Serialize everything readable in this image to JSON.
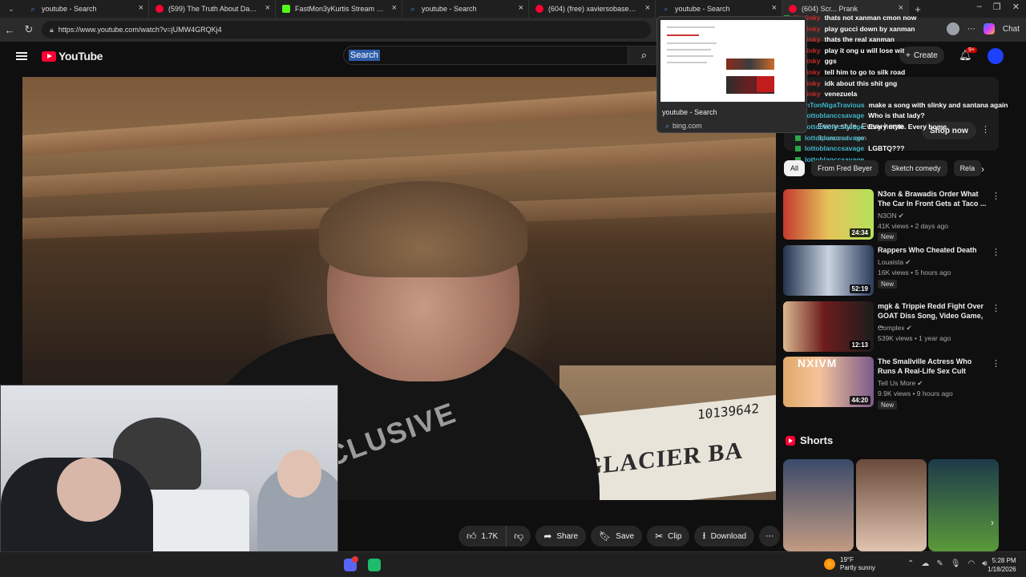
{
  "browser": {
    "tabs": [
      {
        "label": "youtube - Search",
        "favicon": "bing"
      },
      {
        "label": "(599) The Truth About Dark Web Da",
        "favicon": "youtube"
      },
      {
        "label": "FastMon3yKurtis Stream - Watch Liv",
        "favicon": "kick"
      },
      {
        "label": "youtube - Search",
        "favicon": "bing"
      },
      {
        "label": "(604) (free) xaviersobased + ksuuvi",
        "favicon": "youtube"
      },
      {
        "label": "youtube - Search",
        "favicon": "bing"
      },
      {
        "label": "(604) Scr... Prank",
        "favicon": "youtube"
      }
    ],
    "url": "https://www.youtube.com/watch?v=jUMW4GRQKj4",
    "right_label": "Chat"
  },
  "tab_preview": {
    "title": "youtube - Search",
    "url": "bing.com"
  },
  "youtube": {
    "logo_text": "YouTube",
    "search_text": "Search",
    "create_label": "Create",
    "notifications_badge": "9+"
  },
  "video": {
    "box_number": "10139642",
    "box_brand": "GLACIER BA",
    "shirt_text": "XCLUSIVE"
  },
  "actions": {
    "like_count": "1.7K",
    "share": "Share",
    "save": "Save",
    "clip": "Clip",
    "download": "Download"
  },
  "chat": [
    {
      "user": "2kslinky",
      "color": "red",
      "message": "thats not xanman cmon now"
    },
    {
      "user": "2kslinky",
      "color": "red",
      "message": "play gucci down by xanman"
    },
    {
      "user": "2kslinky",
      "color": "red",
      "message": "thats the real xanman"
    },
    {
      "user": "2kslinky",
      "color": "red",
      "message": "play it ong u will lose wit"
    },
    {
      "user": "2kslinky",
      "color": "red",
      "message": "ggs"
    },
    {
      "user": "2kslinky",
      "color": "red",
      "message": "tell him to go to silk road"
    },
    {
      "user": "2kslinky",
      "color": "red",
      "message": "idk about this shit gng"
    },
    {
      "user": "2kslinky",
      "color": "red",
      "message": "venezuela"
    },
    {
      "user": "JohnTonNigaTravious",
      "color": "teal",
      "message": "make a song with slinky and santana again"
    },
    {
      "user": "lottoblanccsavage",
      "color": "teal",
      "message": "Who is that lady?"
    },
    {
      "user": "lottoblanccsavage",
      "color": "teal",
      "message": "Every style. Every home."
    },
    {
      "user": "lottoblanccsavage",
      "color": "teal",
      "message": ""
    },
    {
      "user": "lottoblanccsavage",
      "color": "teal",
      "message": "LGBTQ???"
    },
    {
      "user": "lottoblanccsavage",
      "color": "teal",
      "message": ""
    }
  ],
  "ad": {
    "text": "Every style. Every home.",
    "sponsor": "Sponsored · com",
    "button": "Shop now"
  },
  "chips": [
    "All",
    "From Fred Beyer",
    "Sketch comedy",
    "Rela"
  ],
  "recommendations": [
    {
      "title": "N3on & Brawadis Order What The Car In Front Gets at Taco ...",
      "channel": "N3ON",
      "meta": "41K views • 2 days ago",
      "duration": "24:34",
      "badge": "New"
    },
    {
      "title": "Rappers Who Cheated Death",
      "channel": "Louaista",
      "meta": "16K views • 5 hours ago",
      "duration": "52:19",
      "badge": "New"
    },
    {
      "title": "mgk & Trippie Redd Fight Over GOAT Diss Song, Video Game, ...",
      "channel": "Complex",
      "meta": "539K views • 1 year ago",
      "duration": "12:13",
      "badge": ""
    },
    {
      "title": "The Smallville Actress Who Runs A Real-Life Sex Cult",
      "channel": "Tell Us More",
      "meta": "9.9K views • 9 hours ago",
      "duration": "44:20",
      "badge": "New",
      "thumb_text": "NXIVM"
    }
  ],
  "shorts": {
    "heading": "Shorts"
  },
  "taskbar": {
    "weather_temp": "19°F",
    "weather_desc": "Partly sunny",
    "time": "5:28 PM",
    "date": "1/18/2026"
  }
}
